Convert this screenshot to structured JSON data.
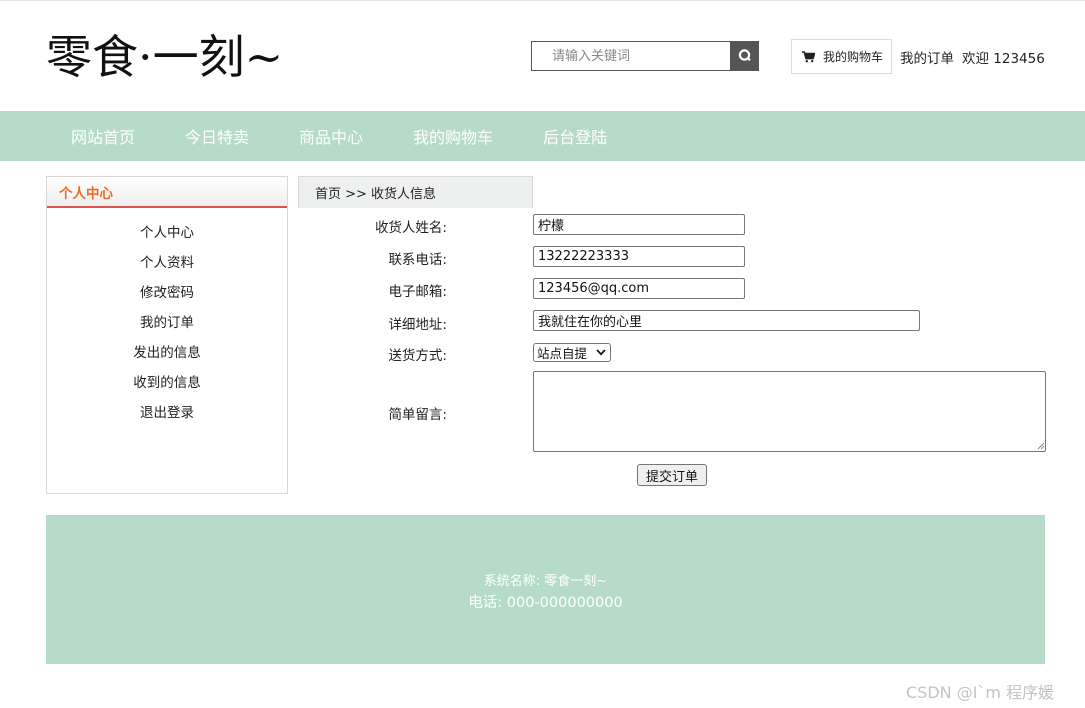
{
  "header": {
    "logo": "零食·一刻~",
    "search": {
      "placeholder": "请输入关键词"
    },
    "cart_label": "我的购物车",
    "orders_link": "我的订单",
    "welcome": "欢迎 123456"
  },
  "nav": {
    "items": [
      {
        "label": "网站首页"
      },
      {
        "label": "今日特卖"
      },
      {
        "label": "商品中心"
      },
      {
        "label": "我的购物车"
      },
      {
        "label": "后台登陆"
      }
    ]
  },
  "sidebar": {
    "title": "个人中心",
    "items": [
      {
        "label": "个人中心"
      },
      {
        "label": "个人资料"
      },
      {
        "label": "修改密码"
      },
      {
        "label": "我的订单"
      },
      {
        "label": "发出的信息"
      },
      {
        "label": "收到的信息"
      },
      {
        "label": "退出登录"
      }
    ]
  },
  "breadcrumb": "首页 >> 收货人信息",
  "form": {
    "name": {
      "label": "收货人姓名:",
      "value": "柠檬"
    },
    "phone": {
      "label": "联系电话:",
      "value": "13222223333"
    },
    "email": {
      "label": "电子邮箱:",
      "value": "123456@qq.com"
    },
    "address": {
      "label": "详细地址:",
      "value": "我就住在你的心里"
    },
    "delivery": {
      "label": "送货方式:",
      "selected": "站点自提"
    },
    "message": {
      "label": "简单留言:",
      "value": ""
    },
    "submit_label": "提交订单"
  },
  "footer": {
    "system_name": "系统名称:   零食一刻~",
    "phone": "电话:   000-000000000"
  },
  "watermark": "CSDN @I`m 程序媛",
  "colors": {
    "nav_bg": "#b6dcc9",
    "sidebar_title": "#ef6a1f",
    "sidebar_underline": "#d9534f",
    "search_button": "#555555"
  }
}
